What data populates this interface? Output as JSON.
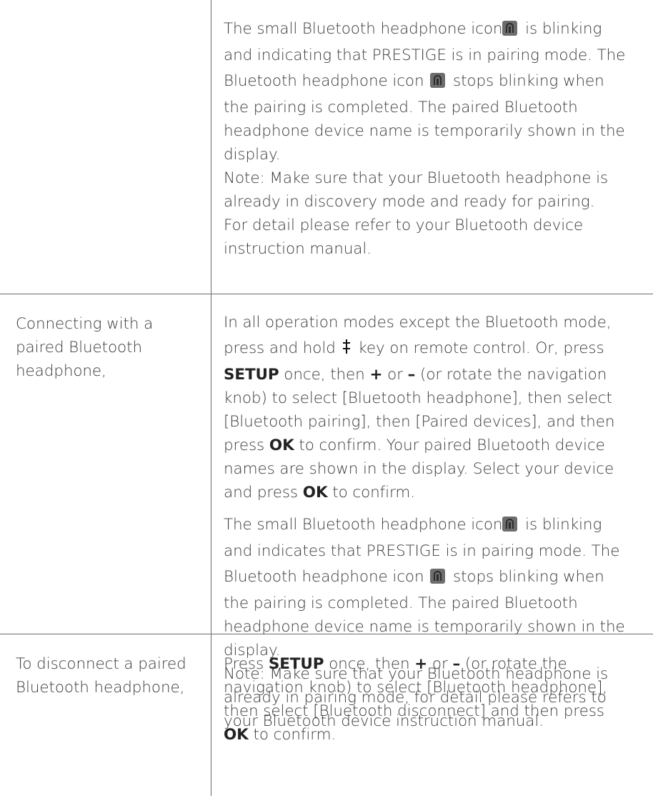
{
  "row1": {
    "content": {
      "l1a": "The small Bluetooth headphone icon",
      "l1b": " is blinking",
      "l2": "and indicating that PRESTIGE is in pairing mode. The",
      "l3a": "Bluetooth headphone icon ",
      "l3b": " stops blinking when",
      "l4": "the pairing is completed. The paired Bluetooth",
      "l5": "headphone device name is temporarily shown in the",
      "l6": "display.",
      "l7": "Note: Make sure that your Bluetooth headphone is",
      "l8": "already in discovery mode and ready for pairing.",
      "l9": "For detail please refer to your Bluetooth device",
      "l10": "instruction manual."
    }
  },
  "row2": {
    "label": [
      "Connecting with a",
      "paired Bluetooth",
      "headphone,"
    ],
    "content": {
      "l1": "In all operation modes except the Bluetooth mode,",
      "l2a": "press and hold ",
      "l2b": " key on remote control. Or, press",
      "l3a": "SETUP",
      "l3b": " once, then ",
      "l3c": "+",
      "l3d": " or ",
      "l3e": "–",
      "l3f": " (or rotate the navigation",
      "l4": "knob) to select [Bluetooth headphone], then select",
      "l5": "[Bluetooth pairing], then [Paired devices], and then",
      "l6a": "press ",
      "l6b": "OK",
      "l6c": " to confirm. Your paired Bluetooth device",
      "l7": "names are shown in the display. Select your device",
      "l8a": "and press ",
      "l8b": "OK",
      "l8c": " to confirm.",
      "p2l1a": "The small Bluetooth headphone icon",
      "p2l1b": " is blinking",
      "p2l2": "and indicates that PRESTIGE is in pairing mode. The",
      "p2l3a": "Bluetooth headphone icon ",
      "p2l3b": " stops blinking when",
      "p2l4": "the pairing is completed. The paired Bluetooth",
      "p2l5": "headphone device name is temporarily shown in the",
      "p2l6": "display.",
      "p2l7": "Note: Make sure that your Bluetooth headphone is",
      "p2l8": "already in pairing mode, for detail please refers to",
      "p2l9": "your Bluetooth device instruction manual."
    }
  },
  "row3": {
    "label": [
      "To disconnect a paired",
      "Bluetooth headphone,"
    ],
    "content": {
      "l1a": "Press ",
      "l1b": "SETUP",
      "l1c": " once, then ",
      "l1d": "+",
      "l1e": " or ",
      "l1f": "–",
      "l1g": " (or rotate the",
      "l2": "navigation knob) to select [Bluetooth headphone],",
      "l3": "then select [Bluetooth disconnect] and then press",
      "l4a": "OK",
      "l4b": " to confirm."
    }
  },
  "icons": {
    "headphone": "bluetooth-headphone-icon",
    "bt_key": "bluetooth-key-icon"
  }
}
